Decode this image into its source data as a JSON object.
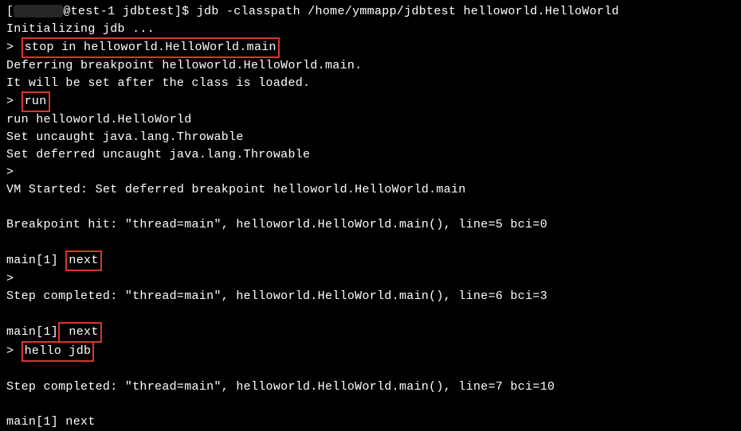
{
  "lines": {
    "l1_prefix": "[",
    "l1_after": "@test-1 jdbtest]$ jdb -classpath /home/ymmapp/jdbtest helloworld.HelloWorld",
    "l2": "Initializing jdb ...",
    "l3_prompt": "> ",
    "l3_cmd": "stop in helloworld.HelloWorld.main",
    "l4": "Deferring breakpoint helloworld.HelloWorld.main.",
    "l5": "It will be set after the class is loaded.",
    "l6_prompt": "> ",
    "l6_cmd": "run",
    "l7": "run helloworld.HelloWorld",
    "l8": "Set uncaught java.lang.Throwable",
    "l9": "Set deferred uncaught java.lang.Throwable",
    "l10": ">",
    "l11": "VM Started: Set deferred breakpoint helloworld.HelloWorld.main",
    "l12": "",
    "l13": "Breakpoint hit: \"thread=main\", helloworld.HelloWorld.main(), line=5 bci=0",
    "l14": "",
    "l15_prompt": "main[1] ",
    "l15_cmd": "next",
    "l16": ">",
    "l17": "Step completed: \"thread=main\", helloworld.HelloWorld.main(), line=6 bci=3",
    "l18": "",
    "l19_prompt": "main[1]",
    "l19_cmd": " next",
    "l20_prompt": "> ",
    "l20_cmd": "hello jdb",
    "l21": "",
    "l22": "Step completed: \"thread=main\", helloworld.HelloWorld.main(), line=7 bci=10",
    "l23": "",
    "l24": "main[1] next"
  }
}
